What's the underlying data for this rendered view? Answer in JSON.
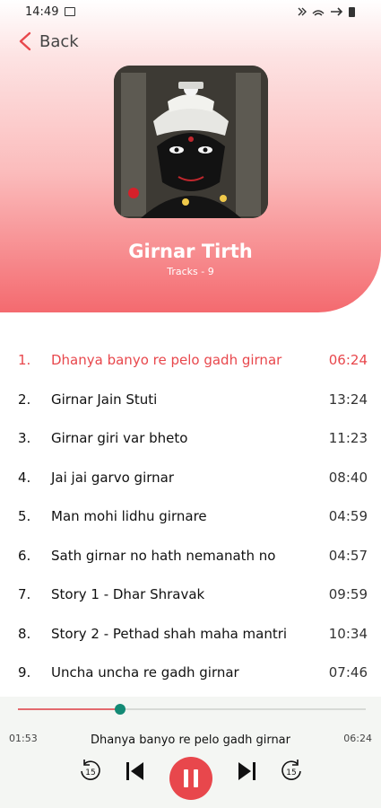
{
  "status_bar": {
    "time": "14:49"
  },
  "header": {
    "back_label": "Back"
  },
  "album": {
    "title": "Girnar Tirth",
    "subtitle": "Tracks - 9"
  },
  "tracks": [
    {
      "num": "1.",
      "name": "Dhanya banyo re pelo gadh girnar",
      "duration": "06:24",
      "active": true
    },
    {
      "num": "2.",
      "name": "Girnar Jain Stuti",
      "duration": "13:24"
    },
    {
      "num": "3.",
      "name": "Girnar giri var bheto",
      "duration": "11:23"
    },
    {
      "num": "4.",
      "name": "Jai jai garvo girnar",
      "duration": "08:40"
    },
    {
      "num": "5.",
      "name": "Man mohi lidhu girnare",
      "duration": "04:59"
    },
    {
      "num": "6.",
      "name": "Sath girnar no hath nemanath no",
      "duration": "04:57"
    },
    {
      "num": "7.",
      "name": "Story 1 - Dhar Shravak",
      "duration": "09:59"
    },
    {
      "num": "8.",
      "name": "Story 2 - Pethad shah maha mantri",
      "duration": "10:34"
    },
    {
      "num": "9.",
      "name": "Uncha uncha re gadh girnar",
      "duration": "07:46"
    }
  ],
  "player": {
    "current_time": "01:53",
    "total_time": "06:24",
    "now_playing": "Dhanya banyo re pelo gadh girnar",
    "progress_fraction": 0.294,
    "rewind_label": "15",
    "forward_label": "15"
  },
  "colors": {
    "accent": "#e8474c",
    "seek_thumb": "#138a75",
    "player_bg": "#f4f6f3"
  }
}
